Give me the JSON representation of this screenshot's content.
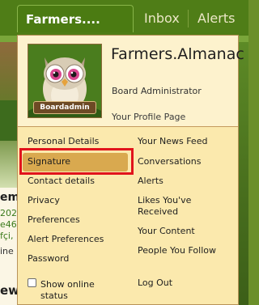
{
  "tabs": {
    "active_label": "Farmers....",
    "inbox_label": "Inbox",
    "alerts_label": "Alerts"
  },
  "background": {
    "fragments": [
      "em",
      "202",
      "e46,",
      "fçi,",
      "ine",
      "ew"
    ]
  },
  "profile": {
    "name": "Farmers.Almanac",
    "role": "Board Administrator",
    "profile_page_link": "Your Profile Page",
    "avatar_badge": "Boardadmin"
  },
  "menu": {
    "left": {
      "personal_details": "Personal Details",
      "signature": "Signature",
      "contact_details": "Contact details",
      "privacy": "Privacy",
      "preferences": "Preferences",
      "alert_preferences": "Alert Preferences",
      "password": "Password",
      "show_online_status": "Show online status"
    },
    "right": {
      "news_feed": "Your News Feed",
      "conversations": "Conversations",
      "alerts": "Alerts",
      "likes_received": "Likes You've Received",
      "your_content": "Your Content",
      "people_you_follow": "People You Follow",
      "log_out": "Log Out"
    }
  },
  "colors": {
    "menu_background": "#fbe9ad",
    "highlight": "#d9a94f",
    "selection_box": "#e1141c",
    "tab_green": "#4b7b12"
  }
}
